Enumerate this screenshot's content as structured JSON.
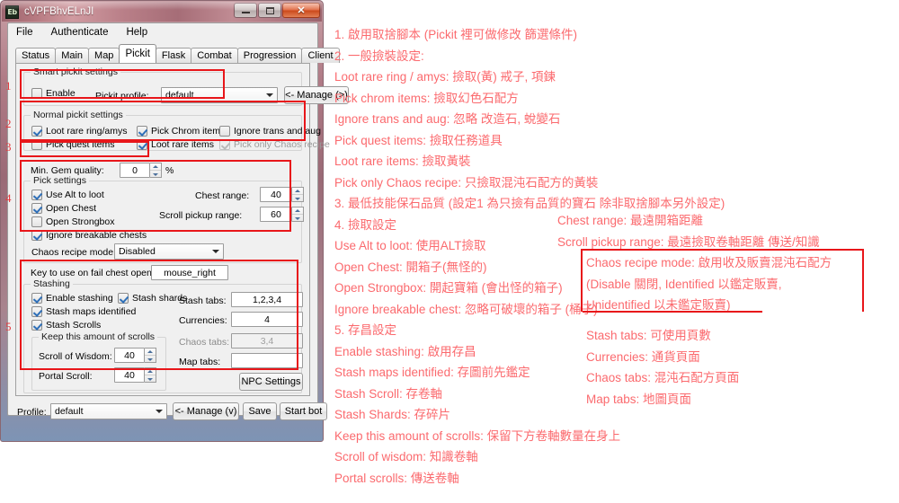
{
  "window": {
    "title": "cVPFBhvELnJI",
    "app_icon": "Eb",
    "buttons": {
      "minimize": "minimize-icon",
      "maximize": "maximize-icon",
      "close": "✕"
    }
  },
  "menubar": {
    "items": [
      "File",
      "Authenticate",
      "Help"
    ]
  },
  "tabs": {
    "items": [
      "Status",
      "Main",
      "Map",
      "Pickit",
      "Flask",
      "Combat",
      "Progression",
      "Client"
    ],
    "active": "Pickit"
  },
  "smart_pickit": {
    "caption": "Smart pickit settings",
    "enable_label": "Enable",
    "enable_checked": false,
    "profile_label": "Pickit profile:",
    "profile_value": "default",
    "manage_label": "<- Manage (>)"
  },
  "normal_pickit": {
    "caption": "Normal pickit settings",
    "checkboxes": [
      {
        "label": "Loot rare ring/amys",
        "checked": true,
        "disabled": false
      },
      {
        "label": "Pick Chrom items",
        "checked": true,
        "disabled": false
      },
      {
        "label": "Ignore trans and aug",
        "checked": false,
        "disabled": false
      },
      {
        "label": "Pick quest items",
        "checked": false,
        "disabled": false
      },
      {
        "label": "Loot rare items",
        "checked": true,
        "disabled": false
      },
      {
        "label": "Pick only Chaos recipe",
        "checked": false,
        "disabled": true
      }
    ]
  },
  "gem_quality": {
    "label": "Min. Gem quality:",
    "value": "0",
    "unit": "%"
  },
  "pick_settings": {
    "caption": "Pick settings",
    "checkboxes": [
      {
        "label": "Use Alt to loot",
        "checked": true
      },
      {
        "label": "Open Chest",
        "checked": true
      },
      {
        "label": "Open Strongbox",
        "checked": false
      },
      {
        "label": "Ignore breakable chests",
        "checked": true
      }
    ],
    "chest_range_label": "Chest range:",
    "chest_range_value": "40",
    "scroll_range_label": "Scroll pickup range:",
    "scroll_range_value": "60",
    "chaos_mode_label": "Chaos recipe mode:",
    "chaos_mode_value": "Disabled",
    "fail_key_label": "Key to use on fail chest opening:",
    "fail_key_value": "mouse_right"
  },
  "stashing": {
    "caption": "Stashing",
    "checkboxes": [
      {
        "label": "Enable stashing",
        "checked": true
      },
      {
        "label": "Stash shards",
        "checked": true
      },
      {
        "label": "Stash maps identified",
        "checked": true
      },
      {
        "label": "Stash Scrolls",
        "checked": true
      }
    ],
    "fields": [
      {
        "label": "Stash tabs:",
        "value": "1,2,3,4",
        "readonly": false
      },
      {
        "label": "Currencies:",
        "value": "4",
        "readonly": false
      },
      {
        "label": "Chaos tabs:",
        "value": "3,4",
        "readonly": true
      },
      {
        "label": "Map tabs:",
        "value": "",
        "readonly": false
      }
    ],
    "keep_caption": "Keep this amount of scrolls",
    "scroll_wisdom_label": "Scroll of Wisdom:",
    "scroll_wisdom_value": "40",
    "portal_scroll_label": "Portal Scroll:",
    "portal_scroll_value": "40",
    "npc_settings_label": "NPC Settings"
  },
  "bottom_bar": {
    "profile_label": "Profile:",
    "profile_value": "default",
    "manage_label": "<- Manage (v)",
    "save_label": "Save",
    "start_label": "Start bot"
  },
  "markers": [
    "1",
    "2",
    "3",
    "4",
    "5"
  ],
  "annotations": {
    "accent_color": "#fb6a6e",
    "box_color": "#e8161a",
    "left_column": [
      "1. 啟用取捨腳本 (Pickit 裡可做修改 篩選條件)",
      "2. 一般撿裝設定:",
      "Loot rare ring / amys: 撿取(黃) 戒子, 項鍊",
      "Pick chrom items: 撿取幻色石配方",
      "Ignore trans and aug: 忽略 改造石, 蛻變石",
      "Pick quest items: 撿取任務道具",
      "Loot rare items: 撿取黃裝",
      "Pick only Chaos recipe: 只撿取混沌石配方的黃裝",
      "3. 最低技能保石品質 (設定1 為只撿有品質的寶石 除非取捨腳本另外設定)",
      "4. 撿取設定",
      "Use Alt to loot: 使用ALT撿取",
      "Open Chest: 開箱子(無怪的)",
      "Open Strongbox: 開起寶箱 (會出怪的箱子)",
      "Ignore breakable chest: 忽略可破壞的箱子 (桶子)",
      "5. 存昌設定",
      "Enable stashing: 啟用存昌",
      "Stash maps identified: 存圖前先鑑定",
      "Stash Scroll: 存卷軸",
      "Stash Shards: 存碎片",
      "Keep this amount of scrolls: 保留下方卷軸數量在身上",
      "Scroll of wisdom: 知識卷軸",
      "Portal scrolls: 傳送卷軸"
    ],
    "mid_column": [
      "Chest range: 最遠開箱距離",
      "Scroll pickup range: 最遠撿取卷軸距離 傳送/知識"
    ],
    "boxed_note": [
      "Chaos recipe mode: 啟用收及販賣混沌石配方",
      "(Disable 關閉, Identified 以鑑定販賣,",
      "Unidentified 以未鑑定販賣)"
    ],
    "right_column": [
      "Stash tabs: 可使用頁數",
      "Currencies: 通貨頁面",
      "Chaos tabs: 混沌石配方頁面",
      "Map tabs: 地圖頁面"
    ]
  }
}
